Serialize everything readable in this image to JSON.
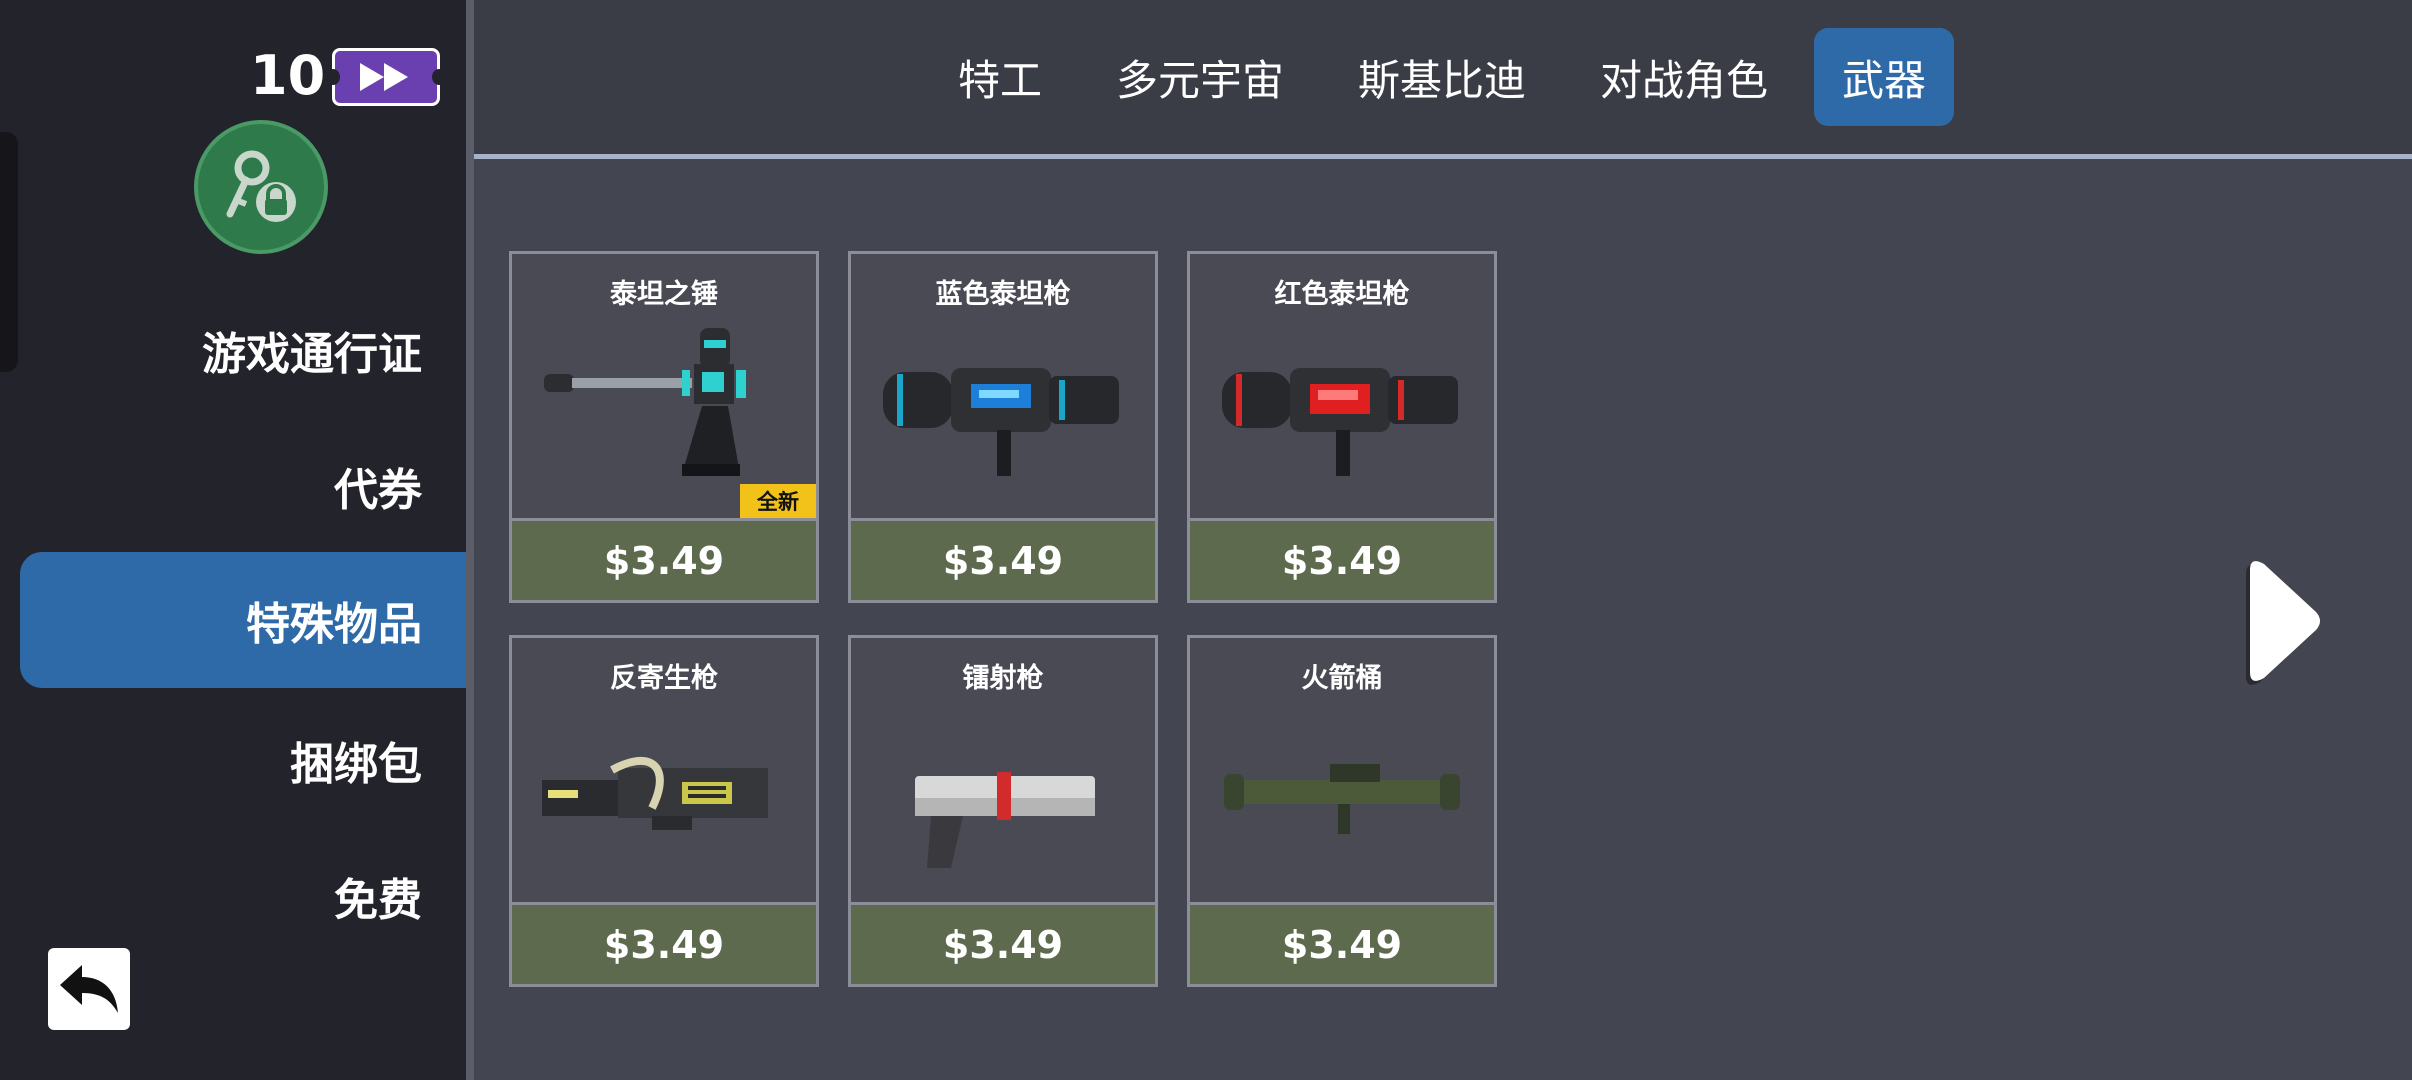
{
  "sidebar": {
    "pass_count": "10",
    "items": [
      {
        "label": "游戏通行证"
      },
      {
        "label": "代券"
      },
      {
        "label": "特殊物品"
      },
      {
        "label": "捆绑包"
      },
      {
        "label": "免费"
      }
    ],
    "active_index": 2
  },
  "tabs": [
    {
      "label": "特工"
    },
    {
      "label": "多元宇宙"
    },
    {
      "label": "斯基比迪"
    },
    {
      "label": "对战角色"
    },
    {
      "label": "武器"
    }
  ],
  "active_tab": 4,
  "cards": [
    {
      "title": "泰坦之锤",
      "price": "$3.49",
      "badge": "全新",
      "icon": "titan-hammer-icon"
    },
    {
      "title": "蓝色泰坦枪",
      "price": "$3.49",
      "icon": "blue-titan-gun-icon"
    },
    {
      "title": "红色泰坦枪",
      "price": "$3.49",
      "icon": "red-titan-gun-icon"
    },
    {
      "title": "反寄生枪",
      "price": "$3.49",
      "icon": "anti-parasite-gun-icon"
    },
    {
      "title": "镭射枪",
      "price": "$3.49",
      "icon": "laser-gun-icon"
    },
    {
      "title": "火箭桶",
      "price": "$3.49",
      "icon": "rocket-launcher-icon"
    }
  ],
  "colors": {
    "sidebar_bg": "#23232b",
    "content_bg": "#434650",
    "active_blue": "#2f6aa8",
    "price_bg": "#5d6a4e",
    "badge_yellow": "#f2c21a",
    "ticket_purple": "#6a3fb0",
    "key_green": "#2f7a4b"
  }
}
